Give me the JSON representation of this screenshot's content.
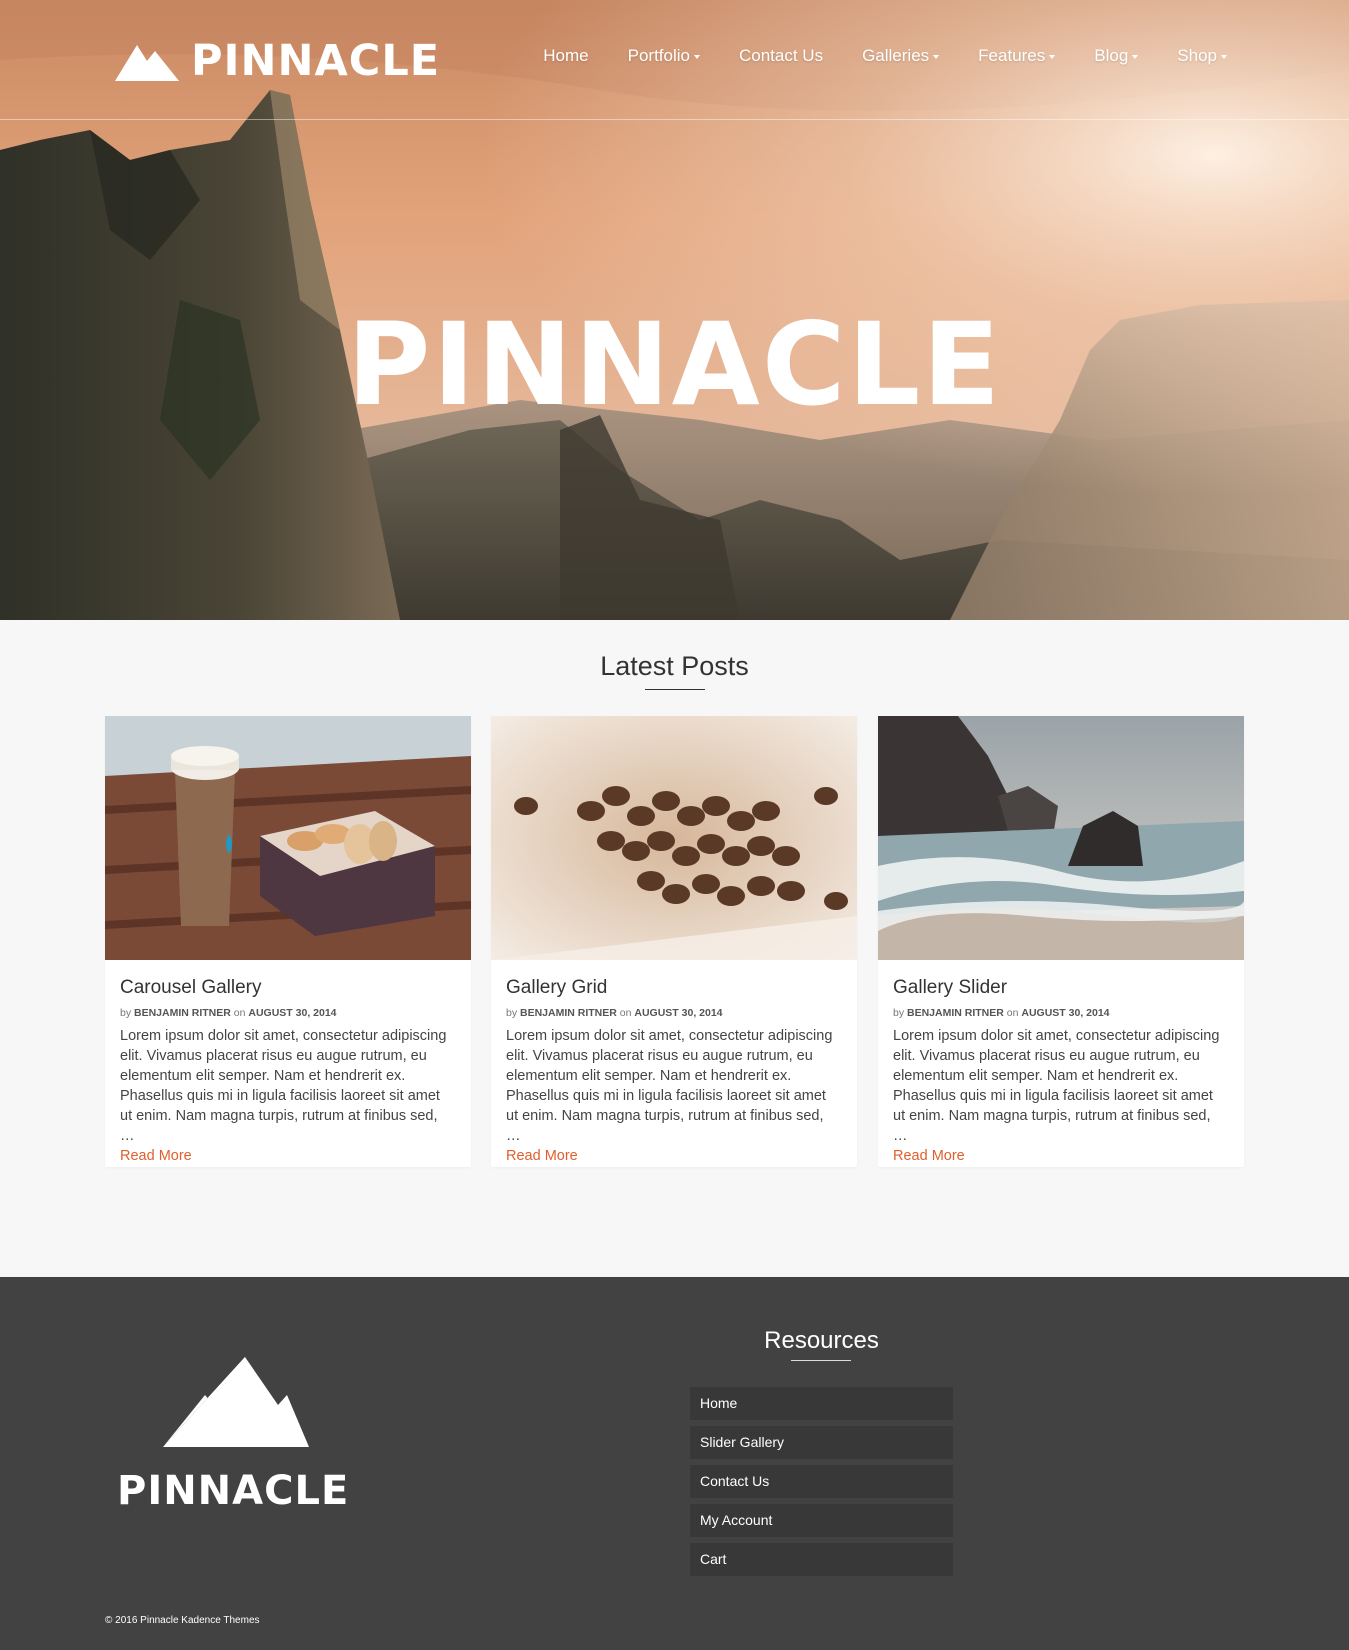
{
  "brand": {
    "name": "PINNACLE"
  },
  "nav": {
    "items": [
      {
        "label": "Home",
        "has_dropdown": false
      },
      {
        "label": "Portfolio",
        "has_dropdown": true
      },
      {
        "label": "Contact Us",
        "has_dropdown": false
      },
      {
        "label": "Galleries",
        "has_dropdown": true
      },
      {
        "label": "Features",
        "has_dropdown": true
      },
      {
        "label": "Blog",
        "has_dropdown": true
      },
      {
        "label": "Shop",
        "has_dropdown": true
      }
    ]
  },
  "hero": {
    "title": "PINNACLE"
  },
  "latest": {
    "heading": "Latest Posts",
    "posts": [
      {
        "title": "Carousel Gallery",
        "by": "by",
        "author": "BENJAMIN RITNER",
        "on": "on",
        "date": "AUGUST 30, 2014",
        "excerpt": "Lorem ipsum dolor sit amet, consectetur adipiscing elit. Vivamus placerat risus eu augue rutrum, eu elementum elit semper. Nam et hendrerit ex. Phasellus quis mi in ligula facilisis laoreet sit amet ut enim. Nam magna turpis, rutrum at finibus sed, …",
        "read_more": "Read More",
        "image": "coffee-cup-macarons"
      },
      {
        "title": "Gallery Grid",
        "by": "by",
        "author": "BENJAMIN RITNER",
        "on": "on",
        "date": "AUGUST 30, 2014",
        "excerpt": "Lorem ipsum dolor sit amet, consectetur adipiscing elit. Vivamus placerat risus eu augue rutrum, eu elementum elit semper. Nam et hendrerit ex. Phasellus quis mi in ligula facilisis laoreet sit amet ut enim. Nam magna turpis, rutrum at finibus sed, …",
        "read_more": "Read More",
        "image": "coffee-beans"
      },
      {
        "title": "Gallery Slider",
        "by": "by",
        "author": "BENJAMIN RITNER",
        "on": "on",
        "date": "AUGUST 30, 2014",
        "excerpt": "Lorem ipsum dolor sit amet, consectetur adipiscing elit. Vivamus placerat risus eu augue rutrum, eu elementum elit semper. Nam et hendrerit ex. Phasellus quis mi in ligula facilisis laoreet sit amet ut enim. Nam magna turpis, rutrum at finibus sed, …",
        "read_more": "Read More",
        "image": "rocky-beach-waves"
      }
    ]
  },
  "footer": {
    "brand": "PINNACLE",
    "resources_title": "Resources",
    "resources": [
      "Home",
      "Slider Gallery",
      "Contact Us",
      "My Account",
      "Cart"
    ],
    "copyright": "© 2016 Pinnacle Kadence Themes"
  },
  "colors": {
    "accent": "#e05f2c",
    "footer_bg": "#424242",
    "footer_item_bg": "#383838",
    "page_bg": "#f7f7f7"
  }
}
